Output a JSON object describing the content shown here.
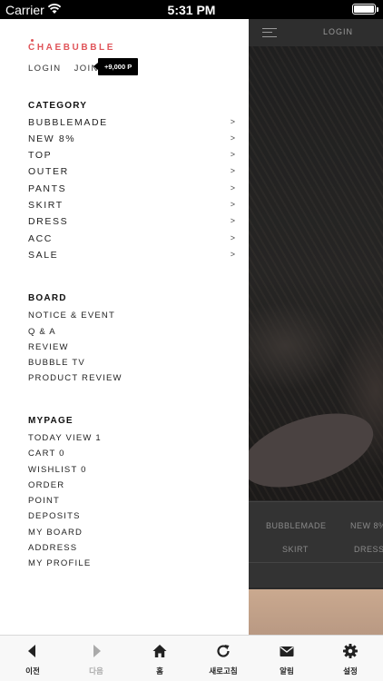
{
  "status_bar": {
    "carrier": "Carrier",
    "time": "5:31 PM"
  },
  "background_page": {
    "header_login": "LOGIN",
    "nav": [
      "BUBBLEMADE",
      "NEW 8%",
      "SKIRT",
      "DRESS"
    ]
  },
  "drawer": {
    "logo": "CHAEBUBBLE",
    "login": "LOGIN",
    "join": "JOIN",
    "join_badge": "+9,000 P",
    "category": {
      "title": "CATEGORY",
      "items": [
        "BUBBLEMADE",
        "NEW 8%",
        "TOP",
        "OUTER",
        "PANTS",
        "SKIRT",
        "DRESS",
        "ACC",
        "SALE"
      ],
      "arrow": ">"
    },
    "board": {
      "title": "BOARD",
      "items": [
        "NOTICE & EVENT",
        "Q & A",
        "REVIEW",
        "BUBBLE TV",
        "PRODUCT REVIEW"
      ]
    },
    "mypage": {
      "title": "MYPAGE",
      "items": [
        "TODAY VIEW 1",
        "CART 0",
        "WISHLIST 0",
        "ORDER",
        "POINT",
        "DEPOSITS",
        "MY BOARD",
        "ADDRESS",
        "MY PROFILE"
      ]
    }
  },
  "toolbar": {
    "items": [
      {
        "label": "이전",
        "icon": "back-arrow-icon"
      },
      {
        "label": "다음",
        "icon": "forward-arrow-icon"
      },
      {
        "label": "홈",
        "icon": "home-icon"
      },
      {
        "label": "새로고침",
        "icon": "refresh-icon"
      },
      {
        "label": "알림",
        "icon": "mail-icon"
      },
      {
        "label": "설정",
        "icon": "gear-icon"
      }
    ]
  },
  "colors": {
    "logo": "#e0555a",
    "disabled": "#aaaaaa"
  }
}
